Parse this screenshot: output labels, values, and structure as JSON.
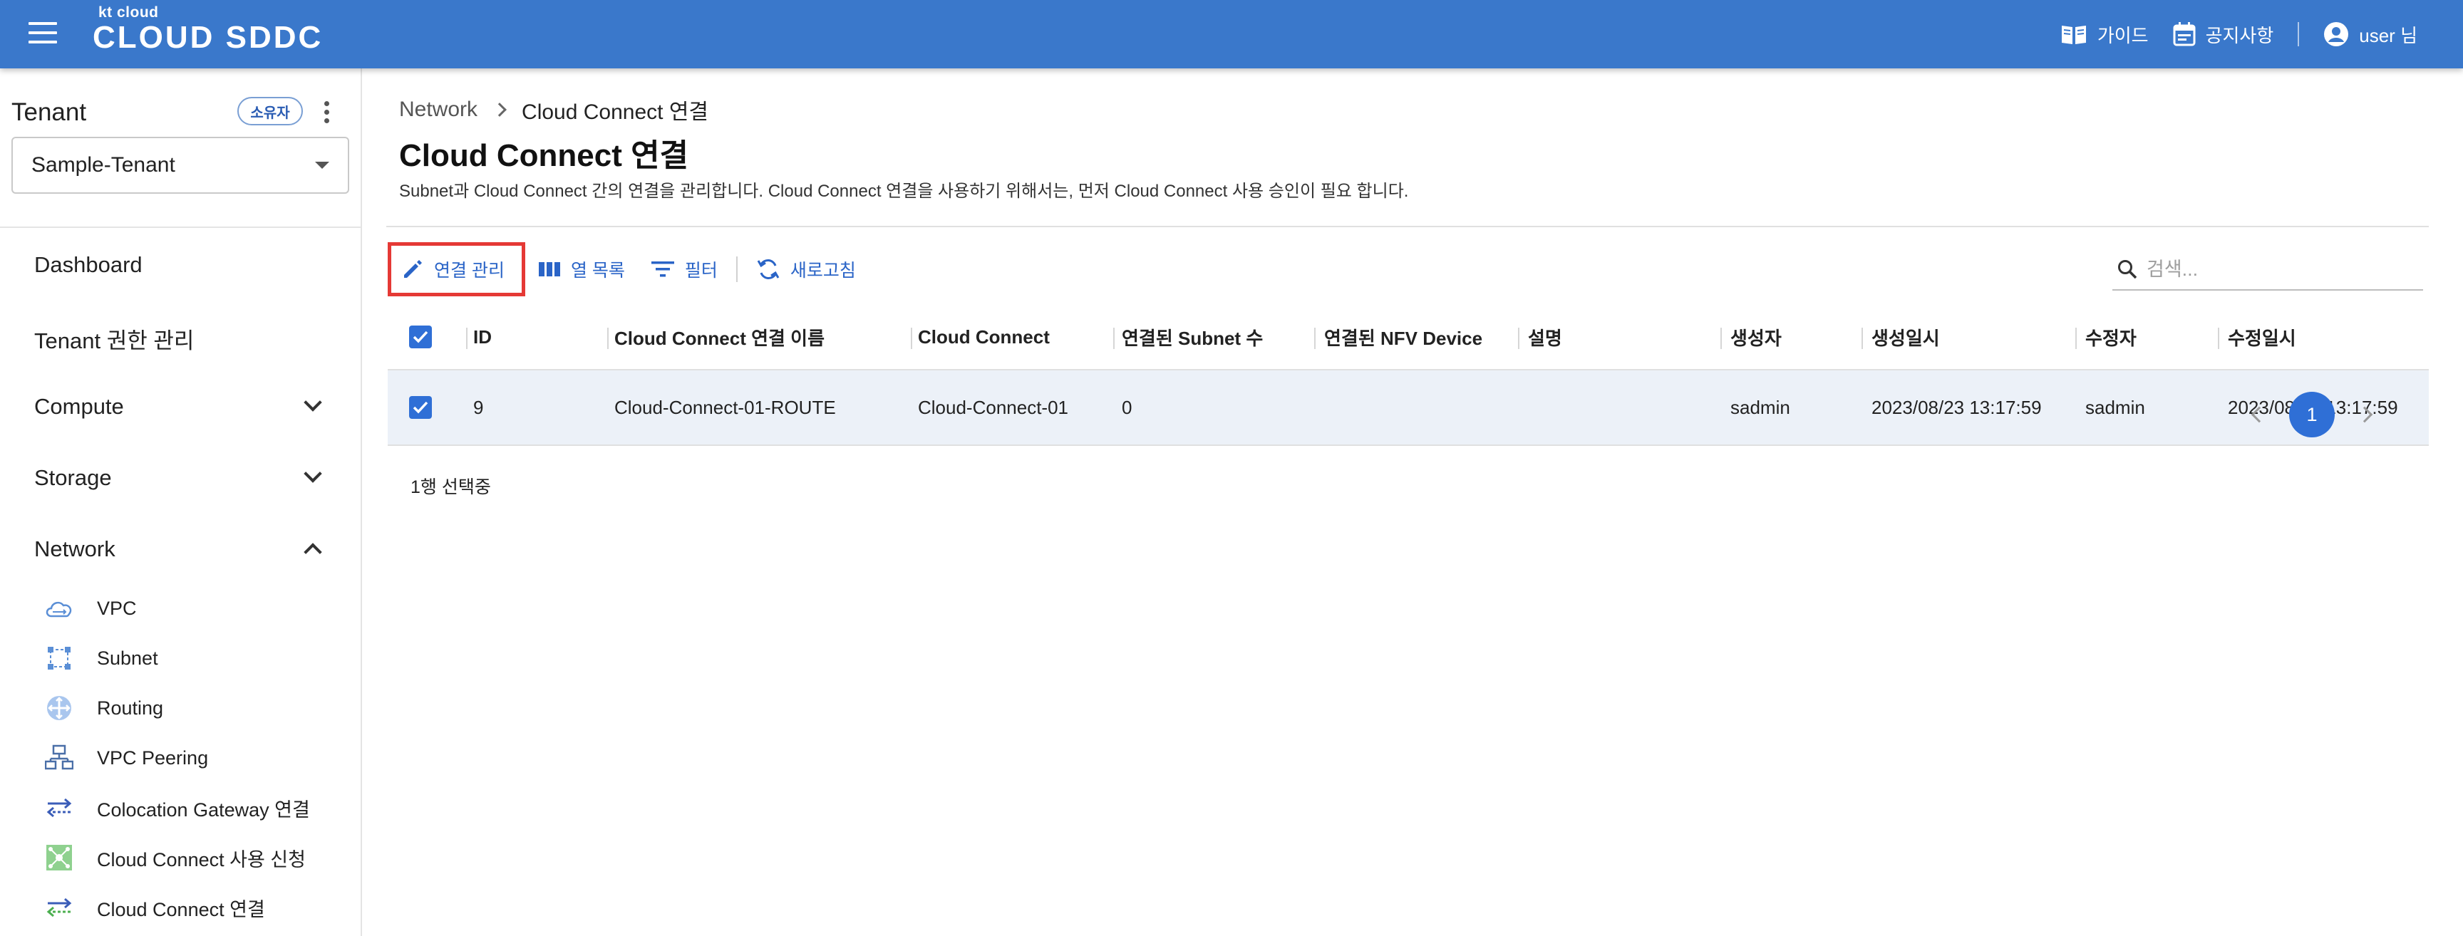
{
  "header": {
    "logo_small": "kt cloud",
    "logo_big": "CLOUD SDDC",
    "guide": "가이드",
    "notice": "공지사항",
    "user": "user 님"
  },
  "sidebar": {
    "tenant_label": "Tenant",
    "owner_badge": "소유자",
    "tenant_value": "Sample-Tenant",
    "nav": {
      "dashboard": "Dashboard",
      "tenant_auth": "Tenant 권한 관리",
      "compute": "Compute",
      "storage": "Storage",
      "network": "Network"
    },
    "network_items": [
      {
        "label": "VPC",
        "icon": "vpc-cloud-icon"
      },
      {
        "label": "Subnet",
        "icon": "subnet-icon"
      },
      {
        "label": "Routing",
        "icon": "routing-icon"
      },
      {
        "label": "VPC Peering",
        "icon": "vpc-peering-icon"
      },
      {
        "label": "Colocation Gateway 연결",
        "icon": "colocation-gateway-icon"
      },
      {
        "label": "Cloud Connect 사용 신청",
        "icon": "cloud-connect-request-icon"
      },
      {
        "label": "Cloud Connect 연결",
        "icon": "cloud-connect-link-icon"
      }
    ]
  },
  "main": {
    "breadcrumb_parent": "Network",
    "breadcrumb_current": "Cloud Connect 연결",
    "title": "Cloud Connect 연결",
    "description": "Subnet과 Cloud Connect 간의 연결을 관리합니다. Cloud Connect 연결을 사용하기 위해서는, 먼저 Cloud Connect 사용 승인이 필요 합니다.",
    "toolbar": {
      "manage": "연결 관리",
      "columns": "열 목록",
      "filter": "필터",
      "refresh": "새로고침"
    },
    "search_placeholder": "검색...",
    "table": {
      "headers": {
        "id": "ID",
        "name": "Cloud Connect 연결 이름",
        "cloud_connect": "Cloud Connect",
        "subnet_count": "연결된 Subnet 수",
        "nfv_device": "연결된 NFV Device",
        "description": "설명",
        "creator": "생성자",
        "created_at": "생성일시",
        "modifier": "수정자",
        "modified_at": "수정일시"
      },
      "rows": [
        {
          "id": "9",
          "name": "Cloud-Connect-01-ROUTE",
          "cloud_connect": "Cloud-Connect-01",
          "subnet_count": "0",
          "nfv_device": "",
          "description": "",
          "creator": "sadmin",
          "created_at": "2023/08/23 13:17:59",
          "modifier": "sadmin",
          "modified_at": "2023/08/23 13:17:59"
        }
      ]
    },
    "selected_count": "1행 선택중",
    "current_page": "1"
  },
  "colors": {
    "header_bg": "#3a78cb",
    "accent": "#2f6fd6",
    "highlight_border": "#e53935",
    "row_selected_bg": "#ecf1f8"
  }
}
